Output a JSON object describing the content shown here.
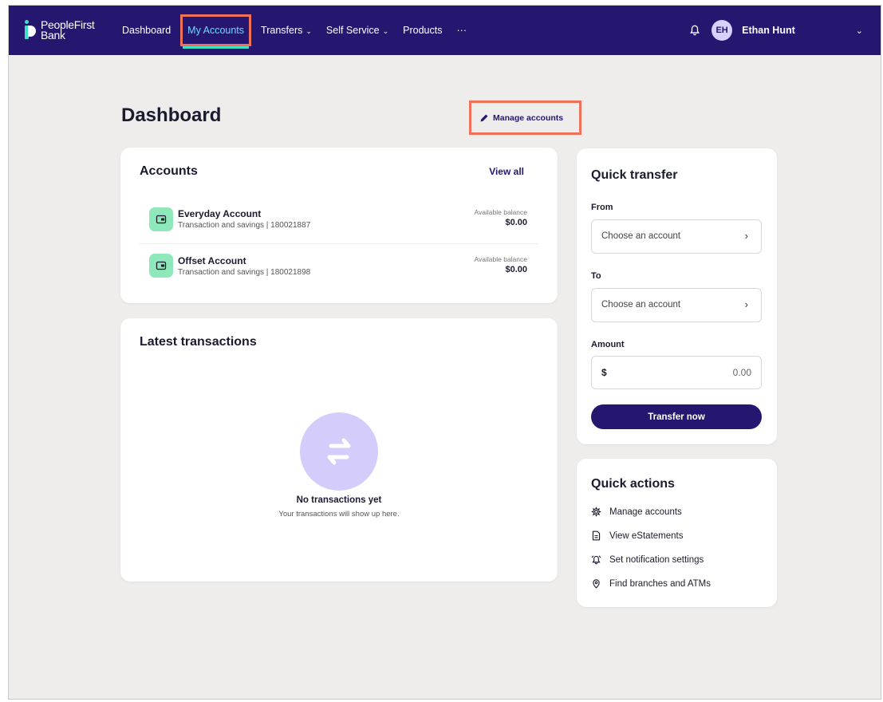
{
  "nav": {
    "logo_line1": "PeopleFirst",
    "logo_line2": "Bank",
    "items": [
      {
        "label": "Dashboard"
      },
      {
        "label": "My Accounts"
      },
      {
        "label": "Transfers"
      },
      {
        "label": "Self Service"
      },
      {
        "label": "Products"
      },
      {
        "label": "···"
      }
    ],
    "user_initials": "EH",
    "user_name": "Ethan Hunt"
  },
  "page": {
    "title": "Dashboard",
    "manage_accounts": "Manage accounts"
  },
  "accounts": {
    "title": "Accounts",
    "view_all": "View all",
    "list": [
      {
        "name": "Everyday Account",
        "sub": "Transaction and savings | 180021887",
        "balance_label": "Available balance",
        "balance": "$0.00"
      },
      {
        "name": "Offset Account",
        "sub": "Transaction and savings | 180021898",
        "balance_label": "Available balance",
        "balance": "$0.00"
      }
    ]
  },
  "transactions": {
    "title": "Latest transactions",
    "empty_title": "No transactions yet",
    "empty_sub": "Your transactions will show up here."
  },
  "quick_transfer": {
    "title": "Quick transfer",
    "from_label": "From",
    "from_placeholder": "Choose an account",
    "to_label": "To",
    "to_placeholder": "Choose an account",
    "amount_label": "Amount",
    "currency": "$",
    "amount_value": "0.00",
    "button": "Transfer now"
  },
  "quick_actions": {
    "title": "Quick actions",
    "items": [
      {
        "label": "Manage accounts",
        "icon": "gear-icon"
      },
      {
        "label": "View eStatements",
        "icon": "document-icon"
      },
      {
        "label": "Set notification settings",
        "icon": "alarm-bell-icon"
      },
      {
        "label": "Find branches and ATMs",
        "icon": "location-pin-icon"
      }
    ]
  },
  "colors": {
    "nav_bg": "#251770",
    "accent": "#3ee0c4",
    "highlight_box": "#f0715a",
    "account_icon_bg": "#8fe8b9",
    "empty_circle": "#d4cdfb"
  }
}
